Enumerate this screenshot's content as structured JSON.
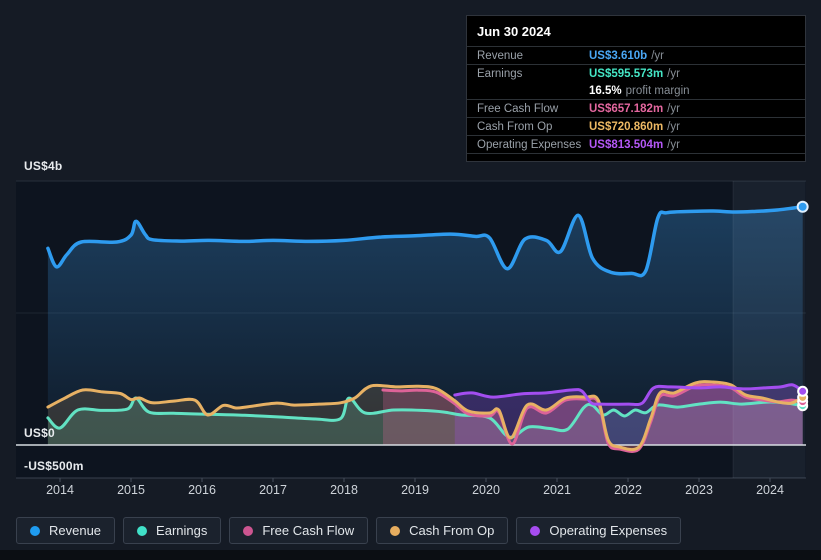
{
  "tooltip": {
    "date": "Jun 30 2024",
    "rows": [
      {
        "label": "Revenue",
        "value": "US$3.610b",
        "suffix": "/yr",
        "color": "#4aa7f5",
        "sub": false
      },
      {
        "label": "Earnings",
        "value": "US$595.573m",
        "suffix": "/yr",
        "color": "#45e6c6",
        "sub": false
      },
      {
        "label": "",
        "value": "16.5%",
        "suffix": "profit margin",
        "color": "#ffffff",
        "sub": true
      },
      {
        "label": "Free Cash Flow",
        "value": "US$657.182m",
        "suffix": "/yr",
        "color": "#e4679f",
        "sub": false
      },
      {
        "label": "Cash From Op",
        "value": "US$720.860m",
        "suffix": "/yr",
        "color": "#edb964",
        "sub": false
      },
      {
        "label": "Operating Expenses",
        "value": "US$813.504m",
        "suffix": "/yr",
        "color": "#b558f7",
        "sub": false
      }
    ]
  },
  "legend": {
    "items": [
      {
        "label": "Revenue",
        "color": "#1f9cf0"
      },
      {
        "label": "Earnings",
        "color": "#40e0c8"
      },
      {
        "label": "Free Cash Flow",
        "color": "#cc5590"
      },
      {
        "label": "Cash From Op",
        "color": "#e6ad5f"
      },
      {
        "label": "Operating Expenses",
        "color": "#a64cf0"
      }
    ]
  },
  "chart_data": {
    "type": "area",
    "title": "",
    "unit": "US$ millions per year",
    "x_ticks": [
      "2014",
      "2015",
      "2016",
      "2017",
      "2018",
      "2019",
      "2020",
      "2021",
      "2022",
      "2023",
      "2024"
    ],
    "y_ticks": [
      {
        "label": "US$4b",
        "value": 4000
      },
      {
        "label": "US$0",
        "value": 0
      },
      {
        "label": "-US$500m",
        "value": -500
      }
    ],
    "ylim": [
      -500,
      4545
    ],
    "grid": true,
    "legend_position": "bottom",
    "highlight_band": {
      "from_year": 2023.48,
      "to_year": 2024.5
    },
    "series": [
      {
        "name": "Revenue",
        "color": "#2e9bef",
        "points": [
          [
            2013.83,
            2980
          ],
          [
            2013.95,
            2700
          ],
          [
            2014.1,
            2890
          ],
          [
            2014.3,
            3075
          ],
          [
            2014.8,
            3075
          ],
          [
            2015.0,
            3180
          ],
          [
            2015.07,
            3390
          ],
          [
            2015.2,
            3190
          ],
          [
            2015.3,
            3110
          ],
          [
            2015.7,
            3090
          ],
          [
            2016.1,
            3100
          ],
          [
            2016.6,
            3085
          ],
          [
            2017.0,
            3100
          ],
          [
            2017.5,
            3085
          ],
          [
            2018.0,
            3100
          ],
          [
            2018.5,
            3150
          ],
          [
            2019.0,
            3170
          ],
          [
            2019.5,
            3195
          ],
          [
            2019.85,
            3160
          ],
          [
            2020.05,
            3140
          ],
          [
            2020.3,
            2670
          ],
          [
            2020.55,
            3120
          ],
          [
            2020.85,
            3100
          ],
          [
            2021.05,
            2930
          ],
          [
            2021.3,
            3480
          ],
          [
            2021.5,
            2830
          ],
          [
            2021.75,
            2620
          ],
          [
            2022.05,
            2600
          ],
          [
            2022.25,
            2640
          ],
          [
            2022.42,
            3440
          ],
          [
            2022.55,
            3520
          ],
          [
            2022.9,
            3540
          ],
          [
            2023.2,
            3545
          ],
          [
            2023.5,
            3530
          ],
          [
            2023.8,
            3540
          ],
          [
            2024.1,
            3560
          ],
          [
            2024.46,
            3610
          ]
        ]
      },
      {
        "name": "Earnings",
        "color": "#62e2c3",
        "points": [
          [
            2013.83,
            410
          ],
          [
            2014.0,
            258
          ],
          [
            2014.25,
            530
          ],
          [
            2014.6,
            525
          ],
          [
            2014.95,
            545
          ],
          [
            2015.07,
            712
          ],
          [
            2015.25,
            500
          ],
          [
            2015.6,
            480
          ],
          [
            2016.1,
            465
          ],
          [
            2016.6,
            450
          ],
          [
            2017.1,
            424
          ],
          [
            2017.6,
            394
          ],
          [
            2017.95,
            400
          ],
          [
            2018.07,
            710
          ],
          [
            2018.3,
            485
          ],
          [
            2018.7,
            530
          ],
          [
            2019.1,
            525
          ],
          [
            2019.4,
            500
          ],
          [
            2019.65,
            455
          ],
          [
            2020.05,
            410
          ],
          [
            2020.33,
            120
          ],
          [
            2020.6,
            273
          ],
          [
            2020.9,
            250
          ],
          [
            2021.15,
            240
          ],
          [
            2021.38,
            570
          ],
          [
            2021.5,
            600
          ],
          [
            2021.65,
            455
          ],
          [
            2021.8,
            530
          ],
          [
            2021.95,
            440
          ],
          [
            2022.1,
            530
          ],
          [
            2022.25,
            490
          ],
          [
            2022.42,
            606
          ],
          [
            2022.7,
            575
          ],
          [
            2023.0,
            620
          ],
          [
            2023.3,
            650
          ],
          [
            2023.6,
            620
          ],
          [
            2023.95,
            650
          ],
          [
            2024.2,
            640
          ],
          [
            2024.46,
            595.573
          ]
        ]
      },
      {
        "name": "Free Cash Flow",
        "color": "#dd6398",
        "points": [
          [
            2018.55,
            833
          ],
          [
            2018.8,
            820
          ],
          [
            2019.05,
            830
          ],
          [
            2019.3,
            800
          ],
          [
            2019.55,
            635
          ],
          [
            2019.75,
            470
          ],
          [
            2020.05,
            440
          ],
          [
            2020.18,
            500
          ],
          [
            2020.37,
            15
          ],
          [
            2020.58,
            560
          ],
          [
            2020.85,
            485
          ],
          [
            2021.12,
            680
          ],
          [
            2021.4,
            695
          ],
          [
            2021.58,
            650
          ],
          [
            2021.72,
            30
          ],
          [
            2021.88,
            -60
          ],
          [
            2022.15,
            -65
          ],
          [
            2022.32,
            350
          ],
          [
            2022.45,
            740
          ],
          [
            2022.65,
            745
          ],
          [
            2022.95,
            895
          ],
          [
            2023.2,
            910
          ],
          [
            2023.45,
            865
          ],
          [
            2023.65,
            730
          ],
          [
            2023.9,
            680
          ],
          [
            2024.12,
            655
          ],
          [
            2024.3,
            680
          ],
          [
            2024.46,
            657.182
          ]
        ]
      },
      {
        "name": "Cash From Op",
        "color": "#e7b164",
        "points": [
          [
            2013.83,
            575
          ],
          [
            2014.05,
            700
          ],
          [
            2014.32,
            833
          ],
          [
            2014.6,
            805
          ],
          [
            2014.85,
            780
          ],
          [
            2015.0,
            690
          ],
          [
            2015.12,
            712
          ],
          [
            2015.3,
            640
          ],
          [
            2015.6,
            665
          ],
          [
            2015.9,
            680
          ],
          [
            2016.08,
            455
          ],
          [
            2016.3,
            600
          ],
          [
            2016.48,
            560
          ],
          [
            2016.65,
            580
          ],
          [
            2017.05,
            635
          ],
          [
            2017.3,
            605
          ],
          [
            2017.65,
            620
          ],
          [
            2017.95,
            640
          ],
          [
            2018.15,
            710
          ],
          [
            2018.38,
            894
          ],
          [
            2018.75,
            880
          ],
          [
            2019.05,
            890
          ],
          [
            2019.3,
            855
          ],
          [
            2019.55,
            680
          ],
          [
            2019.75,
            515
          ],
          [
            2020.05,
            485
          ],
          [
            2020.18,
            530
          ],
          [
            2020.35,
            106
          ],
          [
            2020.58,
            606
          ],
          [
            2020.85,
            530
          ],
          [
            2021.12,
            712
          ],
          [
            2021.4,
            725
          ],
          [
            2021.58,
            680
          ],
          [
            2021.72,
            80
          ],
          [
            2021.88,
            -30
          ],
          [
            2022.15,
            -35
          ],
          [
            2022.32,
            400
          ],
          [
            2022.45,
            788
          ],
          [
            2022.65,
            790
          ],
          [
            2022.95,
            940
          ],
          [
            2023.2,
            955
          ],
          [
            2023.45,
            910
          ],
          [
            2023.65,
            760
          ],
          [
            2023.9,
            710
          ],
          [
            2024.12,
            650
          ],
          [
            2024.3,
            635
          ],
          [
            2024.46,
            720.86
          ]
        ]
      },
      {
        "name": "Operating Expenses",
        "color": "#a34ef0",
        "points": [
          [
            2019.56,
            758
          ],
          [
            2019.8,
            790
          ],
          [
            2020.1,
            725
          ],
          [
            2020.5,
            775
          ],
          [
            2020.85,
            790
          ],
          [
            2021.2,
            833
          ],
          [
            2021.35,
            818
          ],
          [
            2021.48,
            640
          ],
          [
            2021.62,
            620
          ],
          [
            2022.0,
            620
          ],
          [
            2022.2,
            635
          ],
          [
            2022.36,
            865
          ],
          [
            2022.6,
            880
          ],
          [
            2023.0,
            865
          ],
          [
            2023.3,
            880
          ],
          [
            2023.62,
            850
          ],
          [
            2023.92,
            865
          ],
          [
            2024.15,
            880
          ],
          [
            2024.32,
            910
          ],
          [
            2024.46,
            813.504
          ]
        ]
      }
    ]
  }
}
